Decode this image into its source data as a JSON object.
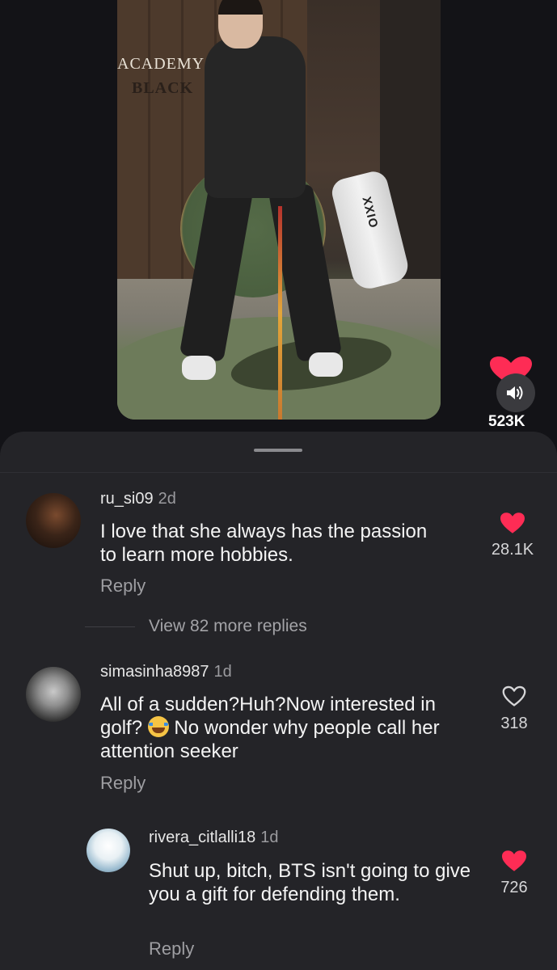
{
  "video": {
    "sign_line1": "ACADEMY",
    "sign_line2": "BLACK",
    "bag_label": "XXIO"
  },
  "actions": {
    "like_count": "523K"
  },
  "comments": [
    {
      "username": "ru_si09",
      "age": "2d",
      "text": "I love that she always has the passion to learn more hobbies.",
      "reply_label": "Reply",
      "likes": "28.1K",
      "liked": true
    },
    {
      "username": "simasinha8987",
      "age": "1d",
      "text_before_emoji": "All of a sudden?Huh?Now interested in golf? ",
      "emoji": "face-with-tears-of-joy",
      "text_after_emoji": " No wonder why people call her attention seeker",
      "reply_label": "Reply",
      "likes": "318",
      "liked": false
    }
  ],
  "view_more": "View 82 more replies",
  "reply_thread": {
    "username": "rivera_citlalli18",
    "age": "1d",
    "text": "Shut up, bitch, BTS isn't going to give you a gift for defending them.",
    "reply_label": "Reply",
    "likes": "726",
    "liked": true
  },
  "colors": {
    "background": "#131317",
    "sheet": "#242428",
    "like_red": "#fe2c55",
    "muted_text": "#9e9ea2"
  },
  "icons": [
    "heart-icon",
    "speaker-icon",
    "heart-outline-icon"
  ]
}
